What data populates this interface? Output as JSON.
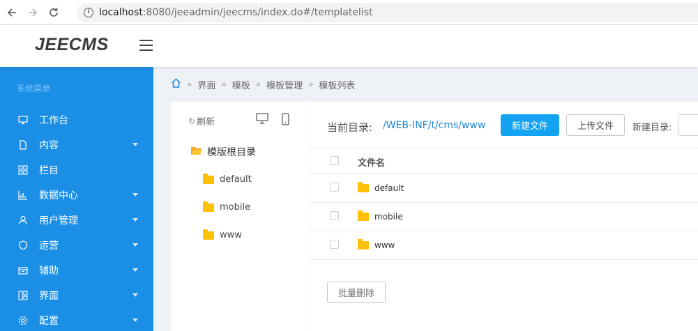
{
  "browser": {
    "url_host": "localhost",
    "url_path": ":8080/jeeadmin/jeecms/index.do#/templatelist"
  },
  "header": {
    "logo": "JEECMS"
  },
  "sidebar": {
    "title": "系统菜单",
    "items": [
      {
        "label": "工作台",
        "icon": "monitor-icon",
        "has_submenu": false
      },
      {
        "label": "内容",
        "icon": "document-icon",
        "has_submenu": true
      },
      {
        "label": "栏目",
        "icon": "grid-icon",
        "has_submenu": false
      },
      {
        "label": "数据中心",
        "icon": "bar-chart-icon",
        "has_submenu": true
      },
      {
        "label": "用户管理",
        "icon": "user-icon",
        "has_submenu": true
      },
      {
        "label": "运营",
        "icon": "shield-icon",
        "has_submenu": true
      },
      {
        "label": "辅助",
        "icon": "box-icon",
        "has_submenu": true
      },
      {
        "label": "界面",
        "icon": "layout-icon",
        "has_submenu": true
      },
      {
        "label": "配置",
        "icon": "gear-icon",
        "has_submenu": true
      }
    ]
  },
  "breadcrumb": {
    "items": [
      "界面",
      "模板",
      "模板管理",
      "模板列表"
    ]
  },
  "tree": {
    "refresh_label": "刷新",
    "root_label": "模版根目录",
    "children": [
      "default",
      "mobile",
      "www"
    ]
  },
  "main": {
    "current_dir_label": "当前目录:",
    "current_dir_path": "/WEB-INF/t/cms/www",
    "new_file_button": "新建文件",
    "upload_file_button": "上传文件",
    "new_dir_label": "新建目录:",
    "table": {
      "header_name": "文件名",
      "rows": [
        "default",
        "mobile",
        "www"
      ]
    },
    "batch_delete_button": "批量删除"
  },
  "colors": {
    "sidebar_bg": "#1b8fe6",
    "primary_button": "#13a3f0",
    "folder": "#ffc107",
    "path_link": "#1e88d6"
  }
}
